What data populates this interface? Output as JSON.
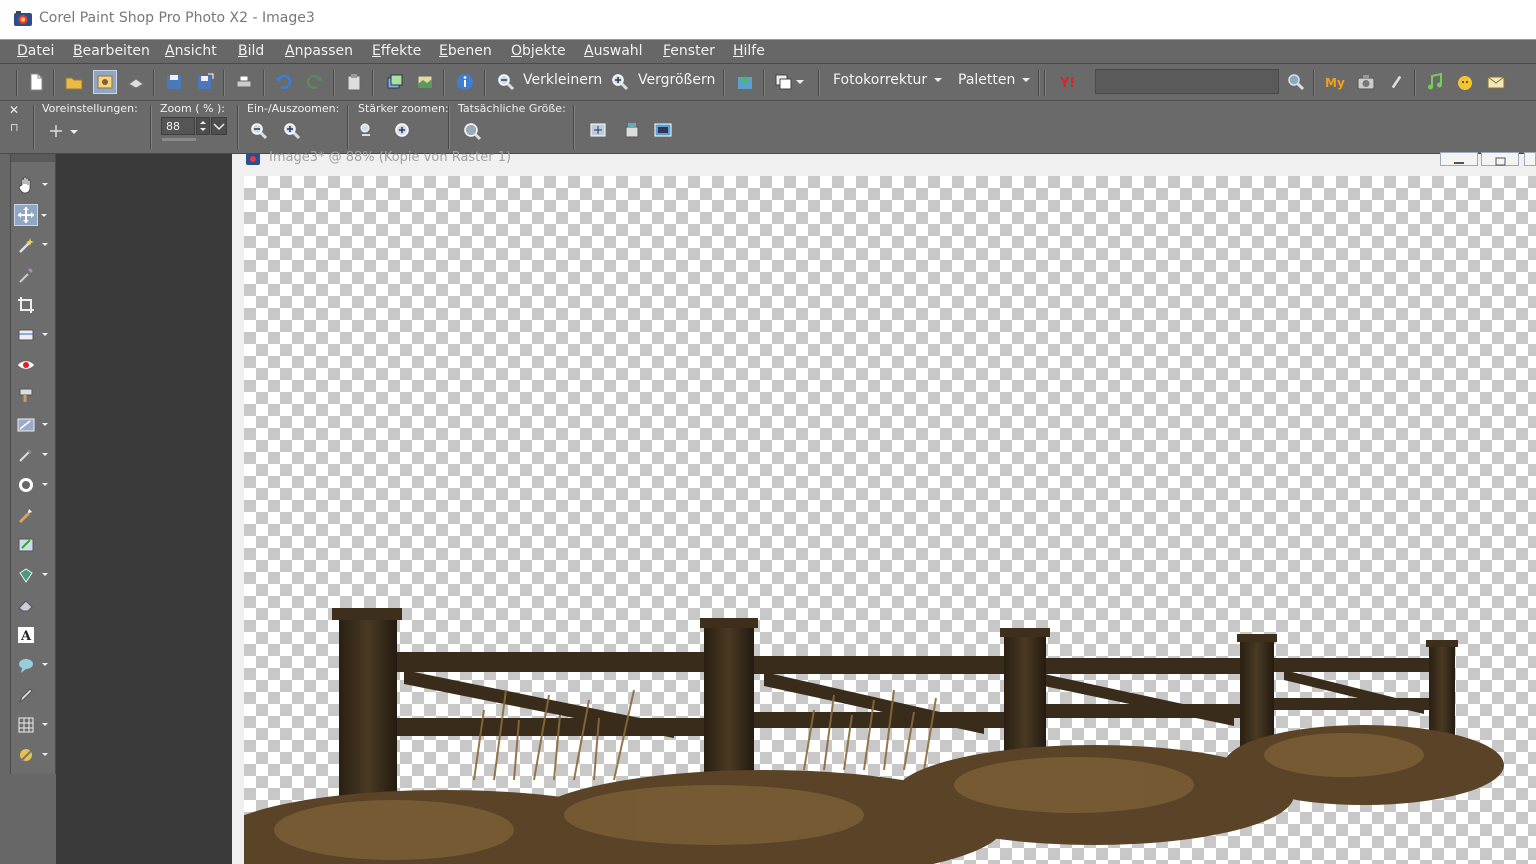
{
  "window": {
    "title": "Corel Paint Shop Pro Photo X2 - Image3"
  },
  "menu": [
    "Datei",
    "Bearbeiten",
    "Ansicht",
    "Bild",
    "Anpassen",
    "Effekte",
    "Ebenen",
    "Objekte",
    "Auswahl",
    "Fenster",
    "Hilfe"
  ],
  "toolbar": {
    "zoom_out_label": "Verkleinern",
    "zoom_in_label": "Vergrößern",
    "photo_fix_label": "Fotokorrektur",
    "palettes_label": "Paletten",
    "search_value": ""
  },
  "options": {
    "presets_label": "Voreinstellungen:",
    "zoom_label": "Zoom ( % ):",
    "zoom_value": "88",
    "zoom_inout_label": "Ein-/Auszoomen:",
    "zoom_more_label": "Stärker zoomen:",
    "actual_size_label": "Tatsächliche Größe:"
  },
  "document": {
    "title": "Image3* @ 88% (Kopie von Raster 1)"
  },
  "colors": {
    "chrome": "#6a6a6a",
    "menubar": "#676767",
    "workspace": "#3a3a3a",
    "fence": "#3a2c1a",
    "grass": "#8a6a3a"
  }
}
